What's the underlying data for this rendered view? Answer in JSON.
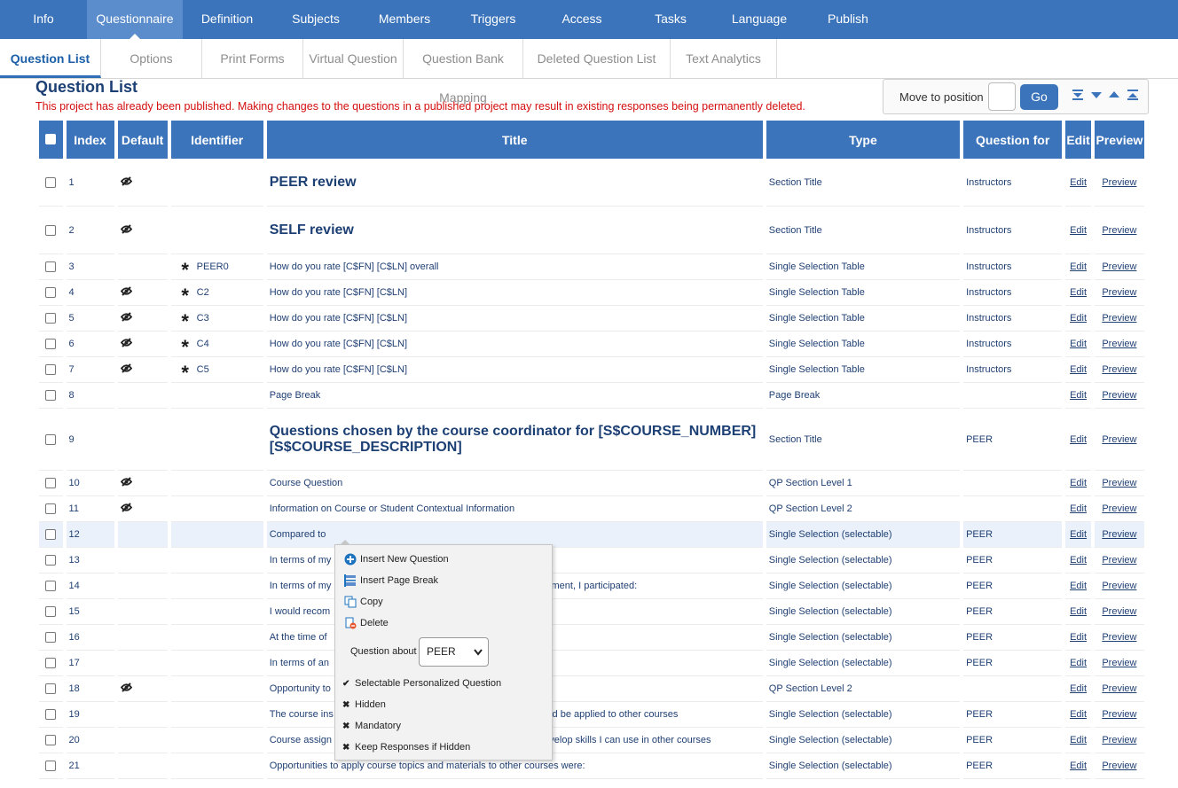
{
  "topnav": {
    "tabs": [
      {
        "label": "Info",
        "w": 98
      },
      {
        "label": "Questionnaire",
        "w": 108,
        "active": true
      },
      {
        "label": "Definition",
        "w": 100
      },
      {
        "label": "Subjects",
        "w": 100
      },
      {
        "label": "Members",
        "w": 100
      },
      {
        "label": "Triggers",
        "w": 100
      },
      {
        "label": "Access",
        "w": 100
      },
      {
        "label": "Tasks",
        "w": 100
      },
      {
        "label": "Language",
        "w": 100
      },
      {
        "label": "Publish",
        "w": 100
      }
    ]
  },
  "subnav": {
    "tabs": [
      {
        "label": "Question List",
        "active": true
      },
      {
        "label": "Options"
      },
      {
        "label": "Print Forms"
      },
      {
        "label": "Virtual Question"
      },
      {
        "label": "Question Bank Mapping"
      },
      {
        "label": "Deleted Question List"
      },
      {
        "label": "Text Analytics"
      }
    ]
  },
  "page": {
    "title": "Question List",
    "warning": "This project has already been published. Making changes to the questions in a published project may result in existing responses being permanently deleted."
  },
  "move": {
    "label": "Move to position",
    "go_label": "Go"
  },
  "table": {
    "headers": {
      "index": "Index",
      "default": "Default",
      "identifier": "Identifier",
      "title": "Title",
      "type": "Type",
      "question_for": "Question for",
      "edit": "Edit",
      "preview": "Preview"
    },
    "edit_label": "Edit",
    "preview_label": "Preview",
    "rows": [
      {
        "index": "1",
        "hidden": true,
        "mandatory": false,
        "identifier": "",
        "title": "PEER review",
        "section": true,
        "type": "Section Title",
        "qfor": "Instructors",
        "size": "tall"
      },
      {
        "index": "2",
        "hidden": true,
        "mandatory": false,
        "identifier": "",
        "title": "SELF review",
        "section": true,
        "type": "Section Title",
        "qfor": "Instructors",
        "size": "tall"
      },
      {
        "index": "3",
        "hidden": false,
        "mandatory": true,
        "identifier": "PEER0",
        "title": "How do you rate [C$FN] [C$LN] overall",
        "type": "Single Selection Table",
        "qfor": "Instructors",
        "size": "norm"
      },
      {
        "index": "4",
        "hidden": true,
        "mandatory": true,
        "identifier": "C2",
        "title": "How do you rate [C$FN] [C$LN]",
        "type": "Single Selection Table",
        "qfor": "Instructors",
        "size": "norm"
      },
      {
        "index": "5",
        "hidden": true,
        "mandatory": true,
        "identifier": "C3",
        "title": "How do you rate [C$FN] [C$LN]",
        "type": "Single Selection Table",
        "qfor": "Instructors",
        "size": "norm"
      },
      {
        "index": "6",
        "hidden": true,
        "mandatory": true,
        "identifier": "C4",
        "title": "How do you rate [C$FN] [C$LN]",
        "type": "Single Selection Table",
        "qfor": "Instructors",
        "size": "norm"
      },
      {
        "index": "7",
        "hidden": true,
        "mandatory": true,
        "identifier": "C5",
        "title": "How do you rate [C$FN] [C$LN]",
        "type": "Single Selection Table",
        "qfor": "Instructors",
        "size": "norm"
      },
      {
        "index": "8",
        "hidden": false,
        "mandatory": false,
        "identifier": "",
        "title": "Page Break",
        "type": "Page Break",
        "qfor": "",
        "size": "norm"
      },
      {
        "index": "9",
        "hidden": false,
        "mandatory": false,
        "identifier": "",
        "title": "Questions chosen by the course coordinator for [S$COURSE_NUMBER] [S$COURSE_DESCRIPTION]",
        "section": true,
        "type": "Section Title",
        "qfor": "PEER",
        "size": "big"
      },
      {
        "index": "10",
        "hidden": true,
        "mandatory": false,
        "identifier": "",
        "title": "Course Question",
        "type": "QP Section Level 1",
        "qfor": "",
        "size": "norm"
      },
      {
        "index": "11",
        "hidden": true,
        "mandatory": false,
        "identifier": "",
        "title": "Information on Course or Student Contextual Information",
        "type": "QP Section Level 2",
        "qfor": "",
        "size": "norm"
      },
      {
        "index": "12",
        "hidden": false,
        "mandatory": false,
        "identifier": "",
        "title": "Compared to",
        "type": "Single Selection (selectable)",
        "qfor": "PEER",
        "size": "norm",
        "selected": true
      },
      {
        "index": "13",
        "hidden": false,
        "mandatory": false,
        "identifier": "",
        "title": "In terms of my",
        "type": "Single Selection (selectable)",
        "qfor": "PEER",
        "size": "norm"
      },
      {
        "index": "14",
        "hidden": false,
        "mandatory": false,
        "identifier": "",
        "title": "In terms of my",
        "title_tail": "nment, I participated:",
        "type": "Single Selection (selectable)",
        "qfor": "PEER",
        "size": "norm"
      },
      {
        "index": "15",
        "hidden": false,
        "mandatory": false,
        "identifier": "",
        "title": "I would recom",
        "type": "Single Selection (selectable)",
        "qfor": "PEER",
        "size": "norm"
      },
      {
        "index": "16",
        "hidden": false,
        "mandatory": false,
        "identifier": "",
        "title": "At the time of",
        "type": "Single Selection (selectable)",
        "qfor": "PEER",
        "size": "norm"
      },
      {
        "index": "17",
        "hidden": false,
        "mandatory": false,
        "identifier": "",
        "title": "In terms of an",
        "type": "Single Selection (selectable)",
        "qfor": "PEER",
        "size": "norm"
      },
      {
        "index": "18",
        "hidden": true,
        "mandatory": false,
        "identifier": "",
        "title": "Opportunity to",
        "type": "QP Section Level 2",
        "qfor": "",
        "size": "norm"
      },
      {
        "index": "19",
        "hidden": false,
        "mandatory": false,
        "identifier": "",
        "title": "The course ins",
        "title_tail": "ould be applied to other courses",
        "type": "Single Selection (selectable)",
        "qfor": "PEER",
        "size": "norm"
      },
      {
        "index": "20",
        "hidden": false,
        "mandatory": false,
        "identifier": "",
        "title": "Course assign",
        "title_tail": "develop skills I can use in other courses",
        "type": "Single Selection (selectable)",
        "qfor": "PEER",
        "size": "norm"
      },
      {
        "index": "21",
        "hidden": false,
        "mandatory": false,
        "identifier": "",
        "title": "Opportunities to apply course topics and materials to other courses were:",
        "type": "Single Selection (selectable)",
        "qfor": "PEER",
        "size": "norm"
      }
    ]
  },
  "context_menu": {
    "insert_new": "Insert New Question",
    "insert_break": "Insert Page Break",
    "copy": "Copy",
    "delete": "Delete",
    "question_about_label": "Question about",
    "question_about_value": "PEER",
    "opt_selectable": "Selectable Personalized Question",
    "opt_hidden": "Hidden",
    "opt_mandatory": "Mandatory",
    "opt_keep": "Keep Responses if Hidden"
  },
  "colors": {
    "nav": "#3b74bb",
    "warning": "#d40f0f",
    "text": "#1f3f73"
  }
}
